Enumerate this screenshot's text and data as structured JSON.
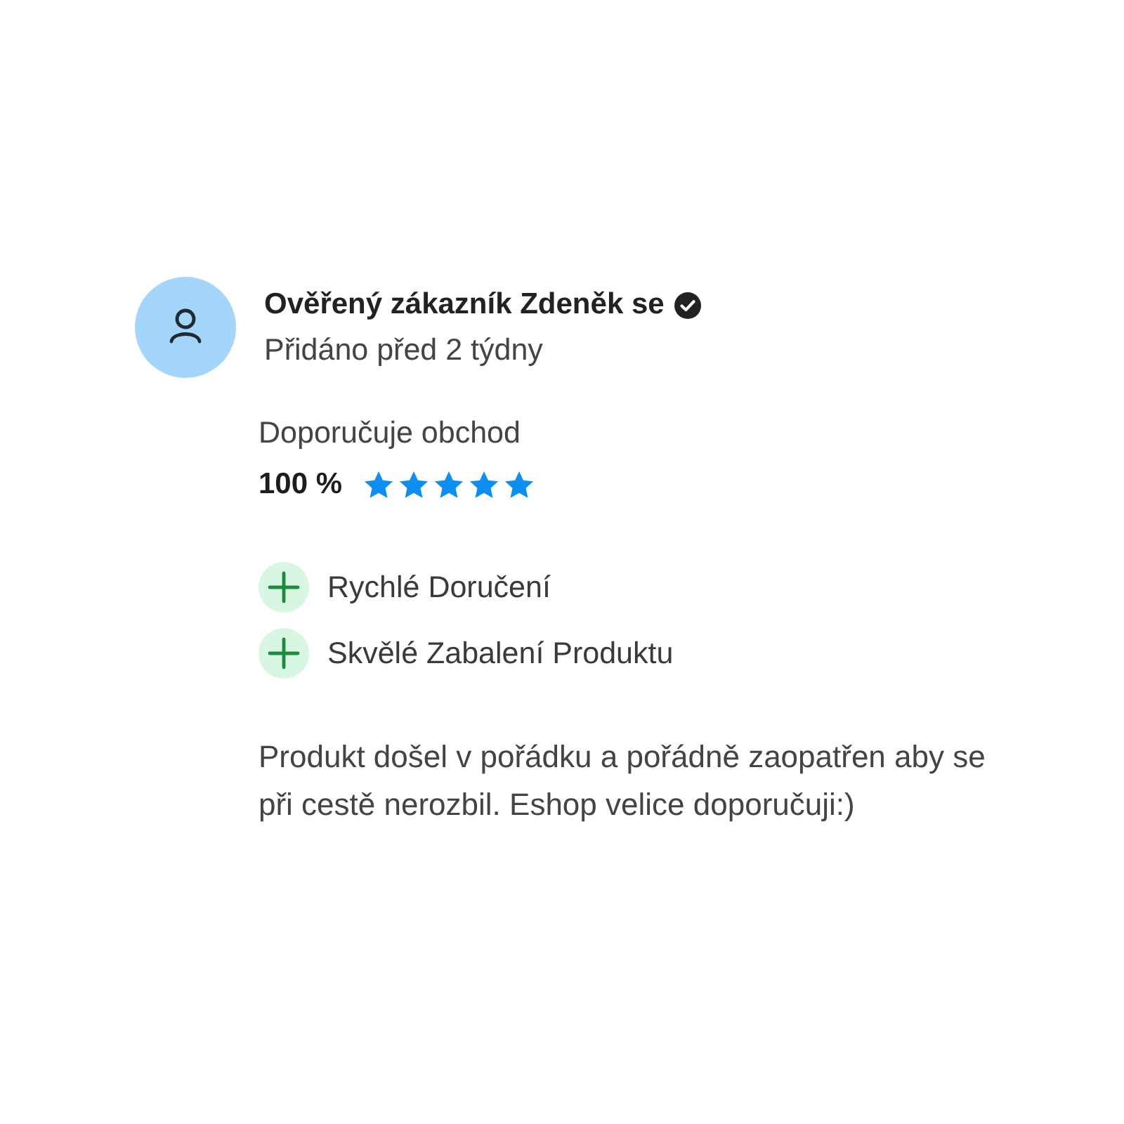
{
  "review": {
    "author": "Ověřený zákazník Zdeněk se",
    "verified": true,
    "added": "Přidáno před 2 týdny",
    "recommend_label": "Doporučuje obchod",
    "recommend_value": "100 %",
    "stars": 5,
    "pros": [
      {
        "kind": "pro",
        "text": "Rychlé Doručení"
      },
      {
        "kind": "pro",
        "text": "Skvělé Zabalení Produktu"
      }
    ],
    "text": "Produkt došel v pořádku a pořádně zaopatřen aby se při cestě nerozbil. Eshop velice doporučuji:)"
  }
}
